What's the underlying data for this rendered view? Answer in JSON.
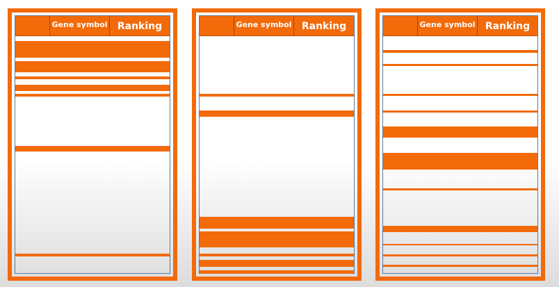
{
  "panels": [
    {
      "header": {
        "col0": "",
        "col1": "Gene symbol",
        "col2": "Ranking"
      }
    },
    {
      "header": {
        "col0": "",
        "col1": "Gene symbol",
        "col2": "Ranking"
      }
    },
    {
      "header": {
        "col0": "",
        "col1": "Gene symbol",
        "col2": "Ranking"
      }
    }
  ],
  "colors": {
    "accent": "#f26a0a",
    "background": "#ffffff"
  }
}
